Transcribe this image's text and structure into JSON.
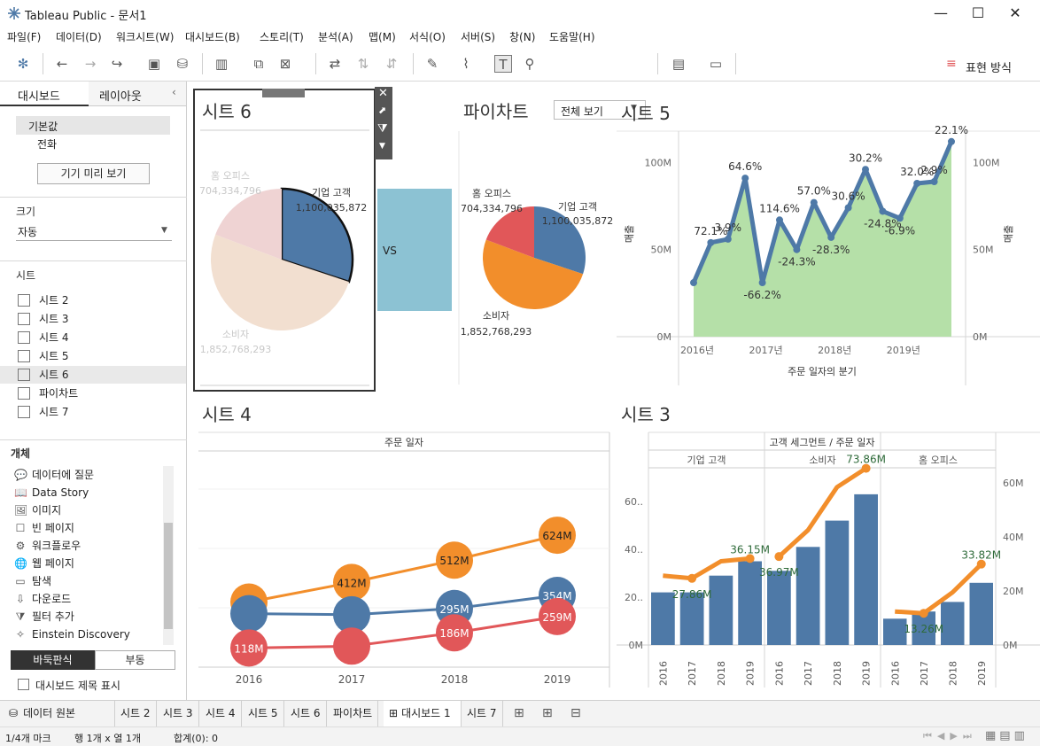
{
  "window": {
    "title": "Tableau Public - 문서1",
    "min": "—",
    "max": "☐",
    "close": "✕"
  },
  "menu": [
    "파일(F)",
    "데이터(D)",
    "워크시트(W)",
    "대시보드(B)",
    "스토리(T)",
    "분석(A)",
    "맵(M)",
    "서식(O)",
    "서버(S)",
    "창(N)",
    "도움말(H)"
  ],
  "toolbar": {
    "view_select": "전체 보기",
    "show_me": "표현 방식"
  },
  "left": {
    "tabs": [
      "대시보드",
      "레이아웃"
    ],
    "device": {
      "default": "기본값",
      "phone": "전화",
      "preview_button": "기기 미리 보기"
    },
    "size": {
      "label": "크기",
      "value": "자동"
    },
    "sheets_label": "시트",
    "sheets": [
      "시트 2",
      "시트 3",
      "시트 4",
      "시트 5",
      "시트 6",
      "파이차트",
      "시트 7"
    ],
    "objects_label": "개체",
    "objects": [
      {
        "icon": "💬",
        "label": "데이터에 질문"
      },
      {
        "icon": "📖",
        "label": "Data Story"
      },
      {
        "icon": "🖼",
        "label": "이미지"
      },
      {
        "icon": "☐",
        "label": "빈 페이지"
      },
      {
        "icon": "⚙",
        "label": "워크플로우"
      },
      {
        "icon": "🌐",
        "label": "웹 페이지"
      },
      {
        "icon": "▭",
        "label": "탐색"
      },
      {
        "icon": "⇩",
        "label": "다운로드"
      },
      {
        "icon": "⧩",
        "label": "필터 추가"
      },
      {
        "icon": "✧",
        "label": "Einstein Discovery"
      }
    ],
    "layout_buttons": [
      "바둑판식",
      "부동"
    ],
    "show_title": "대시보드 제목 표시"
  },
  "tabs": [
    "데이터 원본",
    "시트 2",
    "시트 3",
    "시트 4",
    "시트 5",
    "시트 6",
    "파이차트",
    "대시보드 1",
    "시트 7"
  ],
  "status": {
    "marks": "1/4개 마크",
    "rows": "행 1개 x 열 1개",
    "sum": "합계(0): 0"
  },
  "dashboard": {
    "sheet6": {
      "title": "시트 6",
      "vs": "VS"
    },
    "pie": {
      "title": "파이차트"
    },
    "sheet5": {
      "title": "시트 5"
    },
    "sheet4": {
      "title": "시트 4"
    },
    "sheet3": {
      "title": "시트 3"
    }
  },
  "colors": {
    "blue": "#4e79a7",
    "orange": "#f28e2b",
    "red": "#e15759",
    "green": "#b5e0a8",
    "teal": "#8cc2d3"
  },
  "chart_data": [
    {
      "id": "sheet6",
      "type": "pie",
      "slices": [
        {
          "name": "기업 고객",
          "value": 1100035872,
          "label": "1,100,035,872",
          "color": "#4e79a7",
          "highlighted": true
        },
        {
          "name": "소비자",
          "value": 1852768293,
          "label": "1,852,768,293",
          "color": "#f2dfd0",
          "highlighted": false
        },
        {
          "name": "홈 오피스",
          "value": 704334796,
          "label": "704,334,796",
          "color": "#efd3d3",
          "highlighted": false
        }
      ]
    },
    {
      "id": "pie",
      "type": "pie",
      "slices": [
        {
          "name": "기업 고객",
          "value": 1100035872,
          "label": "1,100,035,872",
          "color": "#4e79a7"
        },
        {
          "name": "소비자",
          "value": 1852768293,
          "label": "1,852,768,293",
          "color": "#f28e2b"
        },
        {
          "name": "홈 오피스",
          "value": 704334796,
          "label": "704,334,796",
          "color": "#e15759"
        }
      ]
    },
    {
      "id": "sheet5",
      "type": "line",
      "xlabel": "주문 일자의 분기",
      "ylabel": "매출",
      "ylabel_right": "매출",
      "x_ticks": [
        "2016년",
        "2017년",
        "2018년",
        "2019년"
      ],
      "y_ticks": [
        "0M",
        "50M",
        "100M"
      ],
      "ylim": [
        0,
        118
      ],
      "values": [
        31,
        54,
        56,
        91,
        31,
        67,
        50,
        77,
        57,
        74,
        96,
        72,
        68,
        88,
        89,
        112
      ],
      "labels": [
        "",
        "72.1%",
        "3.9%",
        "64.6%",
        "-66.2%",
        "114.6%",
        "-24.3%",
        "57.0%",
        "-28.3%",
        "30.6%",
        "30.2%",
        "-24.8%",
        "-6.9%",
        "32.0%",
        "2.9%",
        "22.1%"
      ]
    },
    {
      "id": "sheet4",
      "type": "line",
      "title": "주문 일자",
      "categories": [
        "2016",
        "2017",
        "2018",
        "2019"
      ],
      "ylim": [
        0,
        700
      ],
      "series": [
        {
          "name": "소비자",
          "color": "#f28e2b",
          "values": [
            324,
            412,
            512,
            624
          ],
          "labels": [
            "",
            "412M",
            "512M",
            "624M"
          ]
        },
        {
          "name": "기업 고객",
          "color": "#4e79a7",
          "values": [
            272,
            267,
            295,
            354
          ],
          "labels": [
            "",
            "",
            "295M",
            "354M"
          ]
        },
        {
          "name": "홈 오피스",
          "color": "#e15759",
          "values": [
            118,
            126,
            186,
            259
          ],
          "labels": [
            "118M",
            "",
            "186M",
            "259M"
          ]
        }
      ]
    },
    {
      "id": "sheet3",
      "type": "bar",
      "title": "고객 세그먼트 / 주문 일자",
      "segments": [
        "기업 고객",
        "소비자",
        "홈 오피스"
      ],
      "years": [
        "2016",
        "2017",
        "2018",
        "2019"
      ],
      "y_ticks_left": [
        "0M",
        "20..",
        "40..",
        "60.."
      ],
      "y_ticks_right": [
        "0M",
        "20M",
        "40M",
        "60M"
      ],
      "ylim": [
        0,
        80
      ],
      "bars": [
        [
          22,
          22,
          29,
          35
        ],
        [
          31,
          41,
          52,
          63
        ],
        [
          11,
          14,
          18,
          26
        ]
      ],
      "line": [
        [
          29,
          27.86,
          35,
          36.15
        ],
        [
          36.97,
          48,
          66,
          73.86
        ],
        [
          14,
          13.26,
          22,
          33.82
        ]
      ],
      "line_labels": [
        [
          "",
          "27.86M",
          "",
          "36.15M"
        ],
        [
          "36.97M",
          "",
          "",
          "73.86M"
        ],
        [
          "",
          "13.26M",
          "",
          "33.82M"
        ]
      ]
    }
  ]
}
